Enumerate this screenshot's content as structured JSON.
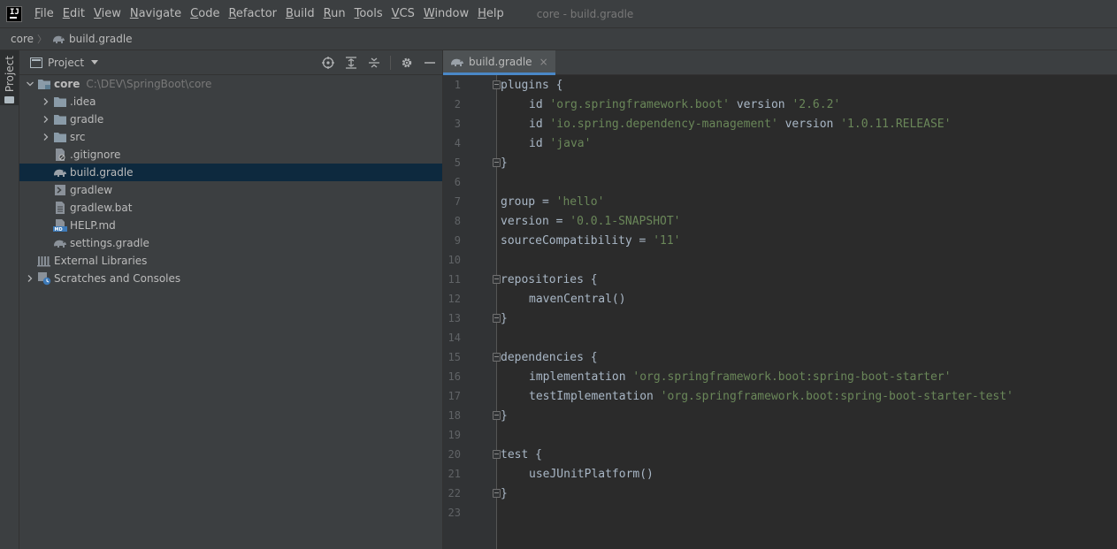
{
  "menubar": {
    "logo": "IJ",
    "items": [
      {
        "mnemonic": "F",
        "rest": "ile"
      },
      {
        "mnemonic": "E",
        "rest": "dit"
      },
      {
        "mnemonic": "V",
        "rest": "iew"
      },
      {
        "mnemonic": "N",
        "rest": "avigate"
      },
      {
        "mnemonic": "C",
        "rest": "ode"
      },
      {
        "mnemonic": "R",
        "rest": "efactor"
      },
      {
        "mnemonic": "B",
        "rest": "uild"
      },
      {
        "mnemonic": "R",
        "rest": "un"
      },
      {
        "mnemonic": "T",
        "rest": "ools"
      },
      {
        "mnemonic": "V",
        "rest": "CS"
      },
      {
        "mnemonic": "W",
        "rest": "indow"
      },
      {
        "mnemonic": "H",
        "rest": "elp"
      }
    ],
    "window_title": "core - build.gradle"
  },
  "breadcrumb": {
    "root": "core",
    "file": "build.gradle"
  },
  "stripe": {
    "project_tab": "Project"
  },
  "project_panel": {
    "title": "Project",
    "tree": {
      "root_name": "core",
      "root_path": "C:\\DEV\\SpringBoot\\core",
      "folders": [
        ".idea",
        "gradle",
        "src"
      ],
      "files": [
        ".gitignore",
        "build.gradle",
        "gradlew",
        "gradlew.bat",
        "HELP.md",
        "settings.gradle"
      ],
      "external_libraries": "External Libraries",
      "scratches": "Scratches and Consoles"
    },
    "selected_file": "build.gradle"
  },
  "editor": {
    "tab_label": "build.gradle",
    "tab_close": "×",
    "lines": [
      {
        "n": "1",
        "t": "plugins {"
      },
      {
        "n": "2",
        "t": "id",
        "s1": "'org.springframework.boot'",
        "m": "version",
        "s2": "'2.6.2'"
      },
      {
        "n": "3",
        "t": "id",
        "s1": "'io.spring.dependency-management'",
        "m": "version",
        "s2": "'1.0.11.RELEASE'"
      },
      {
        "n": "4",
        "t": "id",
        "s1": "'java'"
      },
      {
        "n": "5",
        "t": "}"
      },
      {
        "n": "6",
        "t": ""
      },
      {
        "n": "7",
        "t": "group = ",
        "s1": "'hello'"
      },
      {
        "n": "8",
        "t": "version = ",
        "s1": "'0.0.1-SNAPSHOT'"
      },
      {
        "n": "9",
        "t": "sourceCompatibility = ",
        "s1": "'11'"
      },
      {
        "n": "10",
        "t": ""
      },
      {
        "n": "11",
        "t": "repositories {"
      },
      {
        "n": "12",
        "t": "mavenCentral()"
      },
      {
        "n": "13",
        "t": "}"
      },
      {
        "n": "14",
        "t": ""
      },
      {
        "n": "15",
        "t": "dependencies {"
      },
      {
        "n": "16",
        "t": "implementation",
        "s1": "'org.springframework.boot:spring-boot-starter'"
      },
      {
        "n": "17",
        "t": "testImplementation",
        "s1": "'org.springframework.boot:spring-boot-starter-test'"
      },
      {
        "n": "18",
        "t": "}"
      },
      {
        "n": "19",
        "t": ""
      },
      {
        "n": "20",
        "t": "test {"
      },
      {
        "n": "21",
        "t": "useJUnitPlatform()"
      },
      {
        "n": "22",
        "t": "}"
      },
      {
        "n": "23",
        "t": ""
      }
    ]
  },
  "colors": {
    "string": "#6a8759",
    "code_text": "#a9b7c6",
    "selection": "#0d293e",
    "accent": "#4a88c7"
  }
}
